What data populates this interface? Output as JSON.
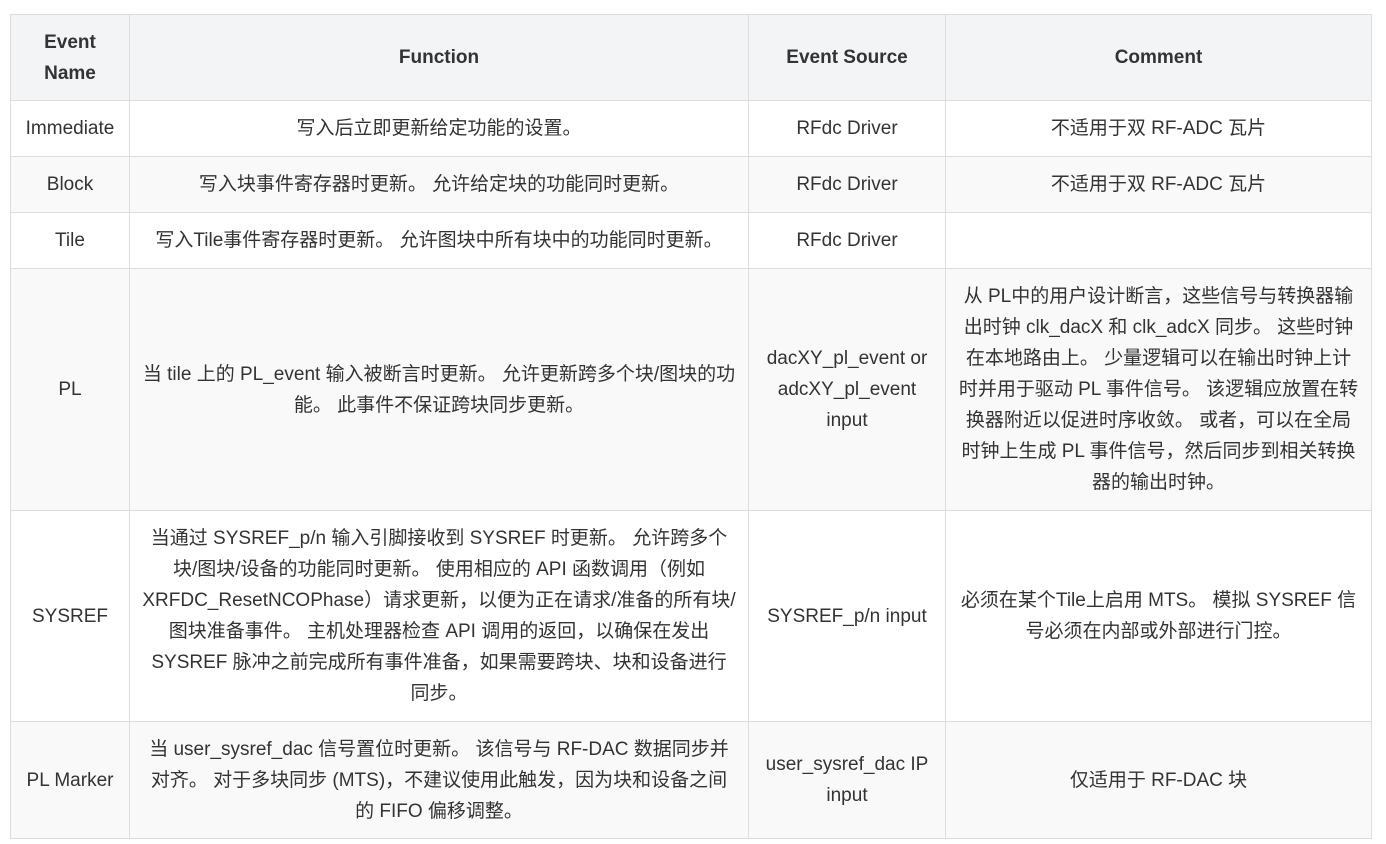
{
  "table": {
    "headers": {
      "event_name": "Event Name",
      "function": "Function",
      "event_source": "Event Source",
      "comment": "Comment"
    },
    "rows": [
      {
        "event_name": "Immediate",
        "function": "写入后立即更新给定功能的设置。",
        "event_source": "RFdc Driver",
        "comment": "不适用于双 RF-ADC 瓦片"
      },
      {
        "event_name": "Block",
        "function": "写入块事件寄存器时更新。 允许给定块的功能同时更新。",
        "event_source": "RFdc Driver",
        "comment": "不适用于双 RF-ADC 瓦片"
      },
      {
        "event_name": "Tile",
        "function": "写入Tile事件寄存器时更新。 允许图块中所有块中的功能同时更新。",
        "event_source": "RFdc Driver",
        "comment": ""
      },
      {
        "event_name": "PL",
        "function": "当 tile 上的 PL_event 输入被断言时更新。 允许更新跨多个块/图块的功能。 此事件不保证跨块同步更新。",
        "event_source": "dacXY_pl_event or adcXY_pl_event input",
        "comment": "从 PL中的用户设计断言，这些信号与转换器输出时钟 clk_dacX 和 clk_adcX 同步。 这些时钟在本地路由上。 少量逻辑可以在输出时钟上计时并用于驱动 PL 事件信号。 该逻辑应放置在转换器附近以促进时序收敛。 或者，可以在全局时钟上生成 PL 事件信号，然后同步到相关转换器的输出时钟。"
      },
      {
        "event_name": "SYSREF",
        "function": "当通过 SYSREF_p/n 输入引脚接收到 SYSREF 时更新。 允许跨多个块/图块/设备的功能同时更新。 使用相应的 API 函数调用（例如 XRFDC_ResetNCOPhase）请求更新，以便为正在请求/准备的所有块/图块准备事件。 主机处理器检查 API 调用的返回，以确保在发出 SYSREF 脉冲之前完成所有事件准备，如果需要跨块、块和设备进行同步。",
        "event_source": "SYSREF_p/n input",
        "comment": "必须在某个Tile上启用 MTS。 模拟 SYSREF 信号必须在内部或外部进行门控。"
      },
      {
        "event_name": "PL Marker",
        "function": "当 user_sysref_dac 信号置位时更新。 该信号与 RF-DAC 数据同步并对齐。 对于多块同步 (MTS)，不建议使用此触发，因为块和设备之间的 FIFO 偏移调整。",
        "event_source": "user_sysref_dac IP input",
        "comment": "仅适用于 RF-DAC 块"
      }
    ]
  }
}
